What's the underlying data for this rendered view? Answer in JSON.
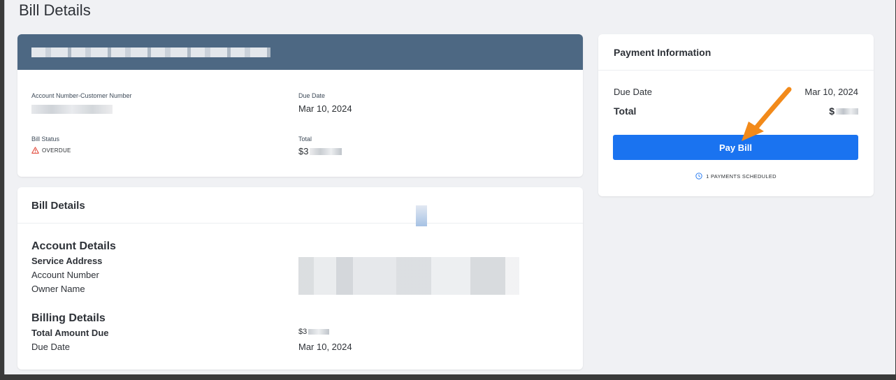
{
  "page": {
    "title": "Bill Details"
  },
  "account": {
    "acct_label": "Account Number-Customer Number",
    "due_label": "Due Date",
    "due_value": "Mar 10, 2024",
    "status_label": "Bill Status",
    "status_value": "OVERDUE",
    "total_label": "Total",
    "total_value": "$3"
  },
  "bill_details": {
    "title": "Bill Details",
    "account_section": "Account Details",
    "service_address": "Service Address",
    "account_number": "Account Number",
    "owner_name": "Owner Name",
    "billing_section": "Billing Details",
    "total_amount_due": "Total Amount Due",
    "total_amount_value": "$3",
    "due_date_label": "Due Date",
    "due_date_value": "Mar 10, 2024"
  },
  "payment": {
    "title": "Payment Information",
    "due_label": "Due Date",
    "due_value": "Mar 10, 2024",
    "total_label": "Total",
    "total_value": "$",
    "pay_button": "Pay Bill",
    "scheduled": "1 PAYMENTS SCHEDULED"
  },
  "colors": {
    "banner": "#4d6883",
    "pay_button": "#1a73f0",
    "warning": "#e24a3b",
    "arrow": "#f28a1a"
  },
  "icons": {
    "warning": "warning-triangle-icon",
    "clock": "clock-icon",
    "arrow": "pointer-arrow-icon"
  }
}
